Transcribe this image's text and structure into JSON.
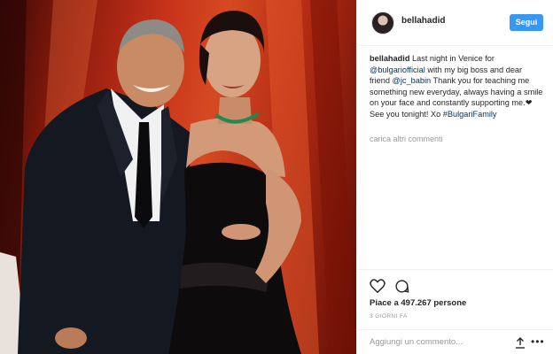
{
  "post": {
    "username": "bellahadid",
    "follow_label": "Segui",
    "caption": {
      "user": "bellahadid",
      "text_1": "Last night in Venice for",
      "mention_1": "@bulgariofficial",
      "text_2": "with my big boss and dear friend",
      "mention_2": "@jc_babin",
      "text_3": "Thank you for teaching me something new everyday, always having a smile on your face and constantly supporting me.",
      "heart": "❤",
      "text_4": "See you tonight! Xo",
      "hashtag": "#BulgariFamily"
    },
    "load_more_comments": "carica altri commenti",
    "likes": "Piace a 497.267 persone",
    "time_ago": "3 GIORNI FA",
    "comment_placeholder": "Aggiungi un commento...",
    "more_label": "•••"
  },
  "icons": {
    "avatar": "avatar",
    "like": "heart-icon",
    "comment": "comment-icon",
    "upload": "upload-icon",
    "more": "more-options-icon"
  },
  "colors": {
    "accent": "#3897f0",
    "link": "#003569",
    "muted": "#999999",
    "text": "#262626"
  }
}
